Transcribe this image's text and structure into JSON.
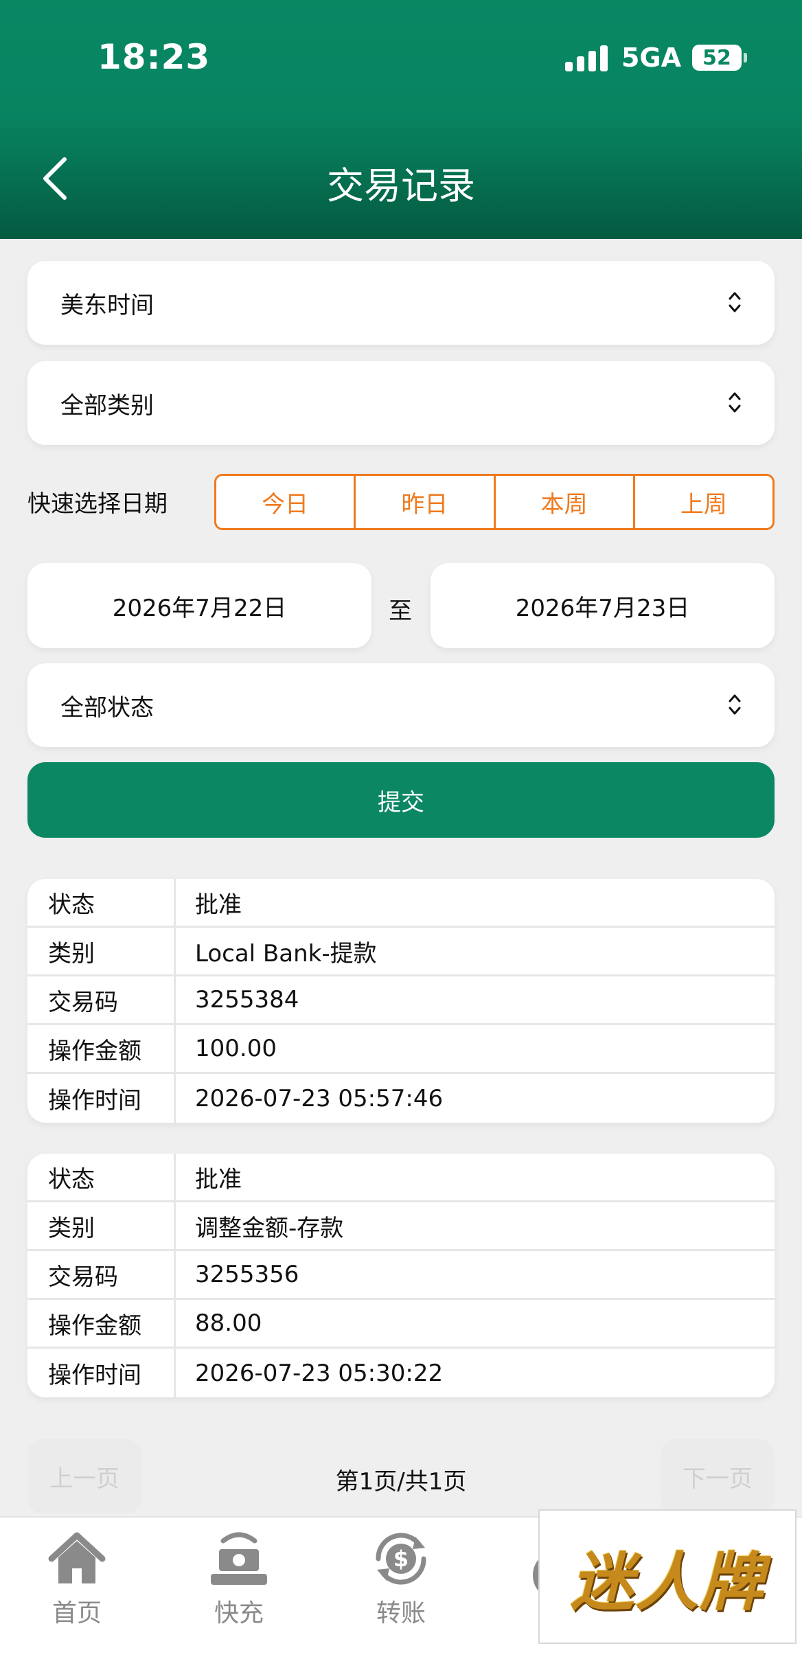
{
  "status_bar": {
    "time": "18:23",
    "network": "5GA",
    "battery": "52"
  },
  "nav": {
    "title": "交易记录"
  },
  "filters": {
    "timezone": "美东时间",
    "category": "全部类别",
    "quick_label": "快速选择日期",
    "quick_options": [
      "今日",
      "昨日",
      "本周",
      "上周"
    ],
    "date_from": "2026年7月22日",
    "date_sep": "至",
    "date_to": "2026年7月23日",
    "status": "全部状态",
    "submit": "提交"
  },
  "records": [
    {
      "rows": [
        {
          "key": "状态",
          "value": "批准"
        },
        {
          "key": "类别",
          "value": "Local Bank-提款"
        },
        {
          "key": "交易码",
          "value": "3255384"
        },
        {
          "key": "操作金额",
          "value": "100.00"
        },
        {
          "key": "操作时间",
          "value": "2026-07-23 05:57:46"
        }
      ]
    },
    {
      "rows": [
        {
          "key": "状态",
          "value": "批准"
        },
        {
          "key": "类别",
          "value": "调整金额-存款"
        },
        {
          "key": "交易码",
          "value": "3255356"
        },
        {
          "key": "操作金额",
          "value": "88.00"
        },
        {
          "key": "操作时间",
          "value": "2026-07-23 05:30:22"
        }
      ]
    }
  ],
  "pager": {
    "prev": "上一页",
    "info": "第1页/共1页",
    "next": "下一页"
  },
  "tabbar": [
    {
      "label": "首页",
      "icon": "home-icon"
    },
    {
      "label": "快充",
      "icon": "quick-charge-icon"
    },
    {
      "label": "转账",
      "icon": "transfer-icon"
    }
  ],
  "badge": {
    "text": "迷人牌"
  }
}
